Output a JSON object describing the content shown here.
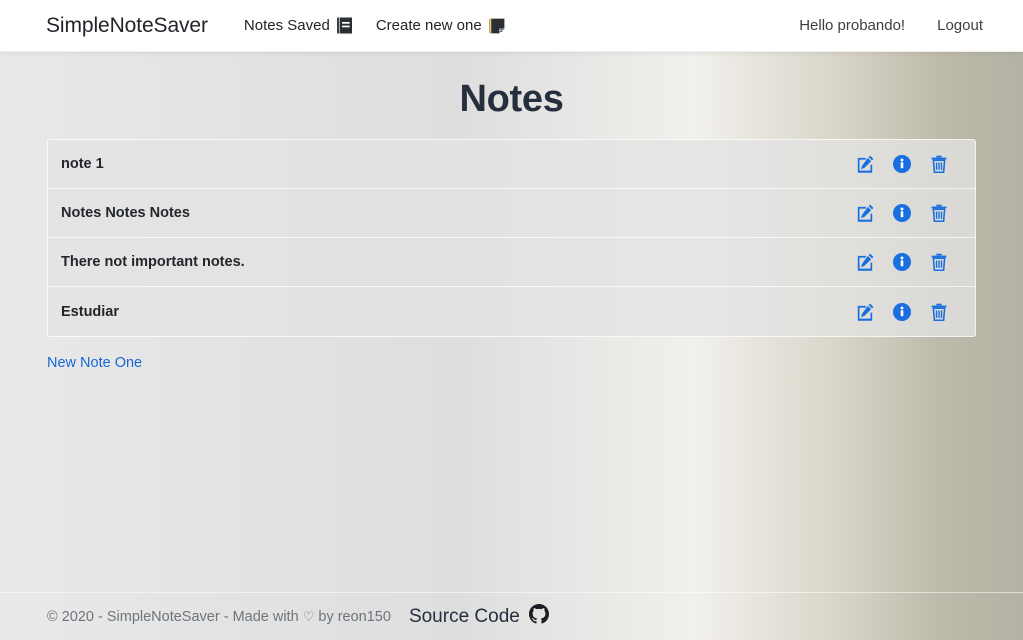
{
  "navbar": {
    "brand": "SimpleNoteSaver",
    "left_links": [
      {
        "label": "Notes Saved",
        "icon": "book-icon"
      },
      {
        "label": "Create new one",
        "icon": "sticky-note-icon"
      }
    ],
    "greeting": "Hello probando!",
    "logout_label": "Logout"
  },
  "main": {
    "page_title": "Notes",
    "notes": [
      {
        "title": "note 1"
      },
      {
        "title": "Notes Notes Notes"
      },
      {
        "title": "There not important notes."
      },
      {
        "title": "Estudiar"
      }
    ],
    "actions": {
      "edit": "edit-icon",
      "details": "info-circle-icon",
      "delete": "trash-icon"
    },
    "new_note_link": "New Note One"
  },
  "footer": {
    "copyright_prefix": "© 2020 - SimpleNoteSaver - Made with",
    "heart": "♡",
    "copyright_suffix": "by reon150",
    "source_code_label": "Source Code",
    "source_code_icon": "github-icon"
  },
  "colors": {
    "accent_blue": "#1768d6",
    "action_blue": "#1a6fe0",
    "title_navy": "#252f3d",
    "footer_text": "#6c757d",
    "navbar_bg": "#ffffff",
    "bg_left": "#e9e9e9",
    "bg_right": "#b3b2a3"
  }
}
